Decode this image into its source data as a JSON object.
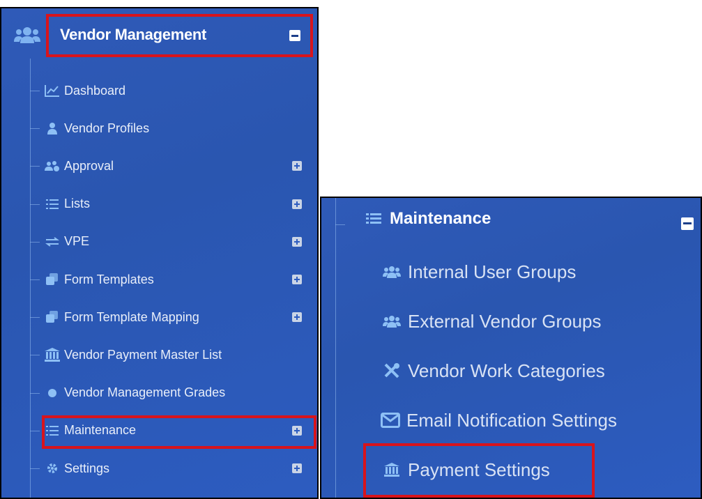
{
  "left_panel": {
    "header": {
      "title": "Vendor Management"
    },
    "items": [
      {
        "label": "Dashboard",
        "icon": "chart-line-icon",
        "expandable": false
      },
      {
        "label": "Vendor Profiles",
        "icon": "user-tie-icon",
        "expandable": false
      },
      {
        "label": "Approval",
        "icon": "users-cog-icon",
        "expandable": true
      },
      {
        "label": "Lists",
        "icon": "list-icon",
        "expandable": true
      },
      {
        "label": "VPE",
        "icon": "exchange-icon",
        "expandable": true
      },
      {
        "label": "Form Templates",
        "icon": "clone-icon",
        "expandable": true
      },
      {
        "label": "Form Template Mapping",
        "icon": "clone-icon",
        "expandable": true
      },
      {
        "label": "Vendor Payment Master List",
        "icon": "bank-icon",
        "expandable": false
      },
      {
        "label": "Vendor Management Grades",
        "icon": "circle-icon",
        "expandable": false
      },
      {
        "label": "Maintenance",
        "icon": "list-icon",
        "expandable": true,
        "highlighted": true
      },
      {
        "label": "Settings",
        "icon": "gear-icon",
        "expandable": true
      }
    ]
  },
  "right_panel": {
    "title": "Maintenance",
    "items": [
      {
        "label": "Internal User Groups",
        "icon": "users-icon"
      },
      {
        "label": "External Vendor Groups",
        "icon": "users-icon"
      },
      {
        "label": "Vendor Work Categories",
        "icon": "tools-icon"
      },
      {
        "label": "Email Notification Settings",
        "icon": "envelope-icon"
      },
      {
        "label": "Payment Settings",
        "icon": "bank-icon",
        "highlighted": true
      }
    ]
  },
  "colors": {
    "panel": "#2d5cc0",
    "highlight": "#d8141c",
    "text": "#e8eef9"
  }
}
